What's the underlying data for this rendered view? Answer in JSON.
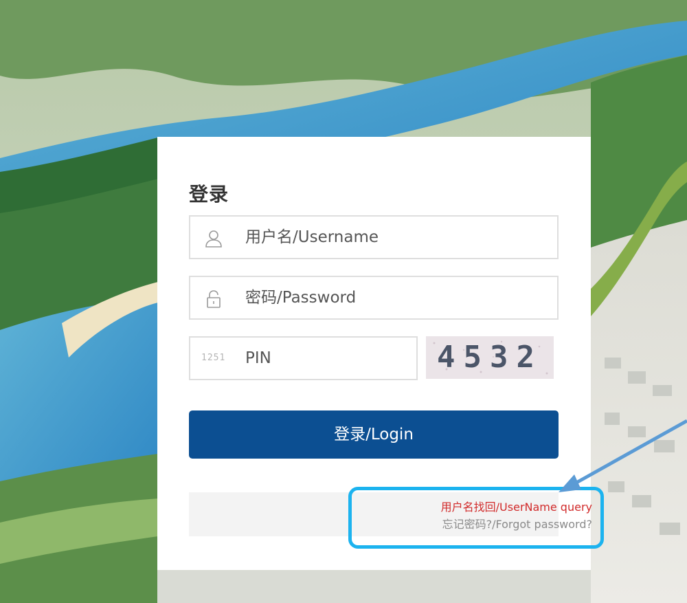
{
  "login": {
    "title": "登录",
    "username_placeholder": "用户名/Username",
    "password_placeholder": "密码/Password",
    "pin_placeholder": "PIN",
    "pin_icon_text": "1251",
    "captcha_code": "4532",
    "login_button": "登录/Login",
    "username_query_link": "用户名找回/UserName query",
    "forgot_password_link": "忘记密码?/Forgot password?"
  },
  "colors": {
    "primary_button": "#0c4f92",
    "username_link": "#d12a2a",
    "highlight_border": "#1cb3ef",
    "annotation_arrow": "#5b9bd5"
  },
  "icons": {
    "username": "user-icon",
    "password": "lock-icon",
    "pin": "pin-code-icon"
  }
}
